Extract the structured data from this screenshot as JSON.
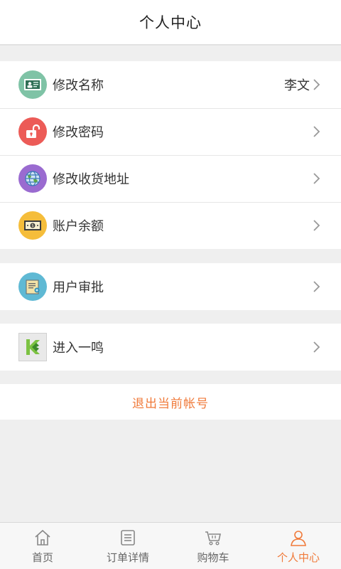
{
  "header": {
    "title": "个人中心"
  },
  "groups": [
    {
      "items": [
        {
          "label": "修改名称",
          "value": "李文",
          "icon": "id-card-icon",
          "color": "#7fc3a6"
        },
        {
          "label": "修改密码",
          "value": "",
          "icon": "unlock-icon",
          "color": "#ec5b57"
        },
        {
          "label": "修改收货地址",
          "value": "",
          "icon": "globe-icon",
          "color": "#9a6bd0"
        },
        {
          "label": "账户余额",
          "value": "",
          "icon": "money-icon",
          "color": "#f5bd3a"
        }
      ]
    },
    {
      "items": [
        {
          "label": "用户审批",
          "value": "",
          "icon": "certificate-icon",
          "color": "#5fb9d4"
        }
      ]
    },
    {
      "items": [
        {
          "label": "进入一鸣",
          "value": "",
          "icon": "yiming-logo-icon",
          "color": "#7cc242"
        }
      ]
    }
  ],
  "logout": {
    "label": "退出当前帐号",
    "color": "#f07a3a"
  },
  "tabbar": {
    "tabs": [
      {
        "label": "首页",
        "icon": "home-icon",
        "active": false
      },
      {
        "label": "订单详情",
        "icon": "list-icon",
        "active": false
      },
      {
        "label": "购物车",
        "icon": "cart-icon",
        "active": false
      },
      {
        "label": "个人中心",
        "icon": "user-icon",
        "active": true
      }
    ]
  }
}
